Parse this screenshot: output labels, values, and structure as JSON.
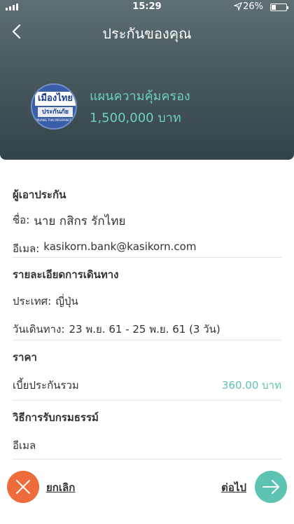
{
  "status_bar": {
    "time": "15:29",
    "battery_percent": "26%",
    "battery_level": 0.26
  },
  "header": {
    "title": "ประกันของคุณ",
    "logo_text_main": "เมืองไทย",
    "logo_text_sub": "ประกันภัย",
    "logo_text_en": "MUANG THAI INSURANCE",
    "plan_label": "แผนความคุ้มครอง",
    "plan_amount": "1,500,000 บาท"
  },
  "insured": {
    "title": "ผู้เอาประกัน",
    "name_label": "ชื่อ:",
    "name_value": "นาย กสิกร รักไทย",
    "email_label": "อีเมล:",
    "email_value": "kasikorn.bank@kasikorn.com"
  },
  "trip": {
    "title": "รายละเอียดการเดินทาง",
    "country_label": "ประเทศ:",
    "country_value": "ญี่ปุ่น",
    "date_label": "วันเดินทาง:",
    "date_value": "23 พ.ย. 61 - 25 พ.ย. 61 (3 วัน)"
  },
  "price": {
    "title": "ราคา",
    "premium_label": "เบี้ยประกันรวม",
    "premium_value": "360.00 บาท"
  },
  "delivery": {
    "title": "วิธีการรับกรมธรรม์",
    "method": "อีเมล"
  },
  "footer": {
    "cancel_label": "ยกเลิก",
    "next_label": "ต่อไป"
  },
  "colors": {
    "accent": "#5fc3b3",
    "cancel": "#ee6b3c"
  }
}
